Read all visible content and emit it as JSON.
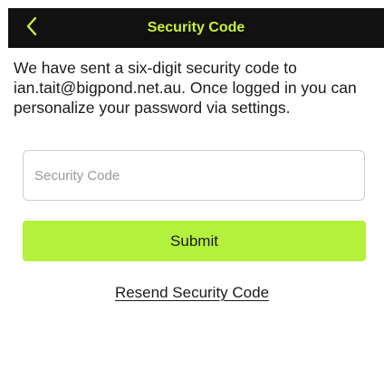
{
  "header": {
    "title": "Security Code",
    "back_icon": "chevron-left-icon",
    "background_color": "#111111",
    "title_color": "#c8f03c"
  },
  "message": "We have sent a six-digit security code to ian.tait@bigpond.net.au. Once logged in you can personalize your password via settings.",
  "security_code_field": {
    "placeholder": "Security Code",
    "value": ""
  },
  "submit_button": {
    "label": "Submit",
    "color": "#b3f13d"
  },
  "resend_link": {
    "label": "Resend Security Code"
  }
}
